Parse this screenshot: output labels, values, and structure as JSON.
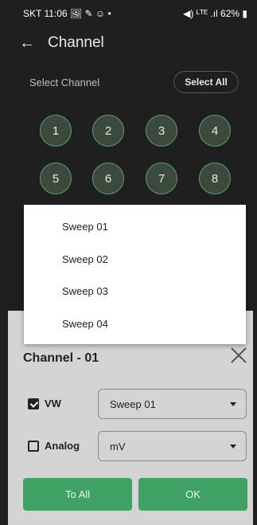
{
  "status": {
    "left": "SKT 11:06 🖼 ✎ ☺ •",
    "right": "◀) ᴸᵀᴱ .ıl 62% ▮"
  },
  "appbar": {
    "title": "Channel"
  },
  "select_channel_label": "Select Channel",
  "select_all_label": "Select All",
  "channels": [
    "1",
    "2",
    "3",
    "4",
    "5",
    "6",
    "7",
    "8"
  ],
  "popup_options": [
    "Sweep 01",
    "Sweep 02",
    "Sweep 03",
    "Sweep 04"
  ],
  "sheet": {
    "title": "Channel - 01",
    "vw_label": "VW",
    "vw_checked": true,
    "vw_value": "Sweep 01",
    "analog_label": "Analog",
    "analog_checked": false,
    "analog_value": "mV",
    "to_all_label": "To All",
    "ok_label": "OK"
  },
  "colors": {
    "accent": "#3fa264",
    "background": "#1f1f1f",
    "sheet": "#d4d4d4"
  }
}
